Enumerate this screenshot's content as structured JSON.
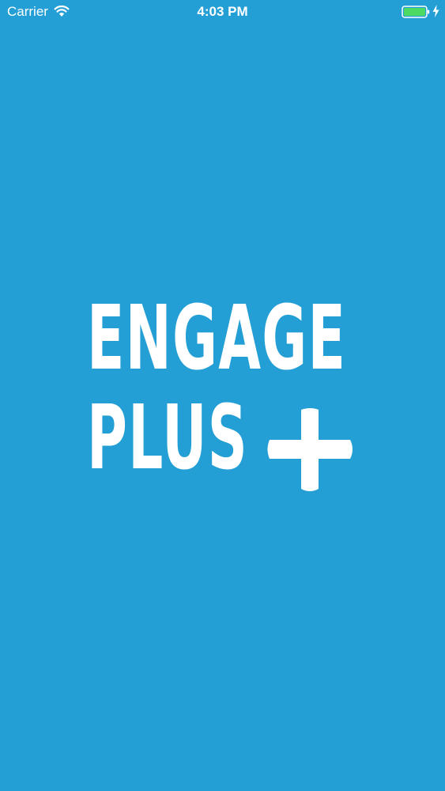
{
  "status_bar": {
    "carrier": "Carrier",
    "time": "4:03 PM",
    "wifi_icon": "wifi-icon",
    "battery_icon": "battery-icon",
    "charging_icon": "charging-bolt-icon",
    "battery_color": "#4cd964"
  },
  "splash": {
    "logo_line_1": "ENGAGE",
    "logo_line_2": "PLUS",
    "plus_icon": "plus-icon",
    "background_color": "#239fd5",
    "logo_color": "#ffffff"
  }
}
